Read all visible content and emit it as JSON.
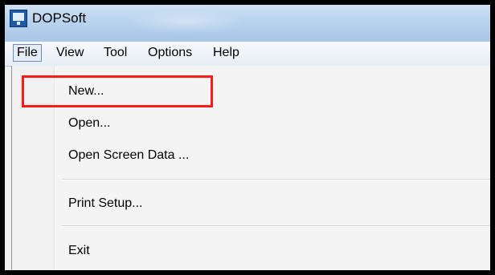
{
  "window": {
    "title": "DOPSoft",
    "app_icon": "dopsoft-app-icon"
  },
  "menubar": {
    "items": [
      {
        "label": "File",
        "active": true
      },
      {
        "label": "View",
        "active": false
      },
      {
        "label": "Tool",
        "active": false
      },
      {
        "label": "Options",
        "active": false
      },
      {
        "label": "Help",
        "active": false
      }
    ]
  },
  "file_menu": {
    "items": [
      {
        "label": "New..."
      },
      {
        "label": "Open..."
      },
      {
        "label": "Open Screen Data ..."
      },
      {
        "label": "Print Setup..."
      },
      {
        "label": "Exit"
      }
    ]
  },
  "annotation": {
    "highlight_color": "#ff1a1a",
    "highlighted_item": "New..."
  }
}
